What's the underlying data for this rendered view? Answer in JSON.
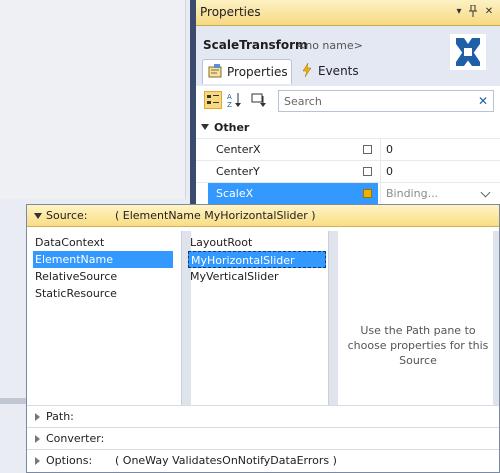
{
  "properties_panel": {
    "title": "Properties",
    "title_buttons": [
      "▾",
      "✕"
    ],
    "type_name": "ScaleTransform",
    "element_name": "<no name>",
    "tabs": [
      {
        "label": "Properties",
        "active": true
      },
      {
        "label": "Events",
        "active": false
      }
    ],
    "search_placeholder": "Search",
    "category": "Other",
    "rows": [
      {
        "name": "CenterX",
        "value": "0"
      },
      {
        "name": "CenterY",
        "value": "0"
      },
      {
        "name": "ScaleX",
        "value": "Binding..."
      }
    ]
  },
  "binding_popup": {
    "source_label": "Source:",
    "source_value": "( ElementName MyHorizontalSlider )",
    "sources": [
      "DataContext",
      "ElementName",
      "RelativeSource",
      "StaticResource"
    ],
    "selected_source": "ElementName",
    "elements": [
      "LayoutRoot",
      "MyHorizontalSlider",
      "MyVerticalSlider"
    ],
    "selected_element": "MyHorizontalSlider",
    "hint": "Use the Path pane to choose properties for this Source",
    "sections": [
      {
        "label": "Path:",
        "value": ""
      },
      {
        "label": "Converter:",
        "value": ""
      },
      {
        "label": "Options:",
        "value": "( OneWay ValidatesOnNotifyDataErrors )"
      }
    ]
  },
  "colors": {
    "selection": "#3399ff",
    "title_bar": "#f6d983",
    "header_bg": "#e3e8f3"
  }
}
